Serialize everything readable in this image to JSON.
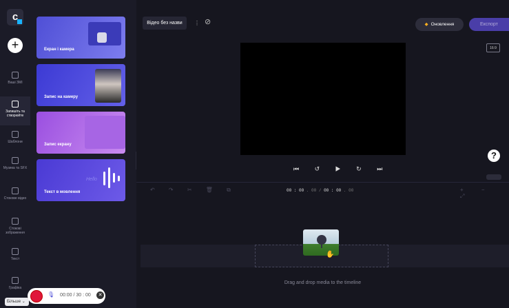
{
  "rail": {
    "logo": "c",
    "add_symbol": "+",
    "items": [
      {
        "label": "Ваші ЗМІ",
        "icon": "folder-icon"
      },
      {
        "label": "Запишіть та створюйте",
        "icon": "camera-icon"
      },
      {
        "label": "Шаблони",
        "icon": "templates-icon"
      },
      {
        "label": "Музика та SFX",
        "icon": "music-icon"
      },
      {
        "label": "Стокове відео",
        "icon": "film-icon"
      },
      {
        "label": "Стокові зображення",
        "icon": "image-icon"
      },
      {
        "label": "Текст",
        "icon": "text-icon"
      },
      {
        "label": "Графіка",
        "icon": "shapes-icon"
      }
    ],
    "more_label": "Більше ⌄"
  },
  "panel": {
    "cards": [
      {
        "label": "Екран і камера"
      },
      {
        "label": "Запис на камеру"
      },
      {
        "label": "Запис екрану"
      },
      {
        "label": "Текст в мовлення",
        "deco": "Hello"
      }
    ]
  },
  "header": {
    "title": "Відео без назви",
    "kebab": "⋮",
    "cloud_icon": "cloud-off-icon",
    "upgrade_label": "Оновлення",
    "upgrade_gem": "◆",
    "export_label": "Експорт",
    "ratio": "16:9"
  },
  "player": {
    "controls": "⏮ ↺ ▶ ↻ ⏭"
  },
  "timeline": {
    "tools": "↶ ↷ ✂ 🗑 ⧉",
    "time_current": "00 : 00",
    "time_current_frac": ". 00",
    "time_sep": "/",
    "time_total": "00 : 00",
    "time_total_frac": ". 00",
    "zoom": "+ − ⤢",
    "drop_hint": "Drag and drop media to the timeline"
  },
  "help": "?",
  "recorder": {
    "time": "00:00 / 30 : 00",
    "close": "✕",
    "mic": "🎙"
  }
}
